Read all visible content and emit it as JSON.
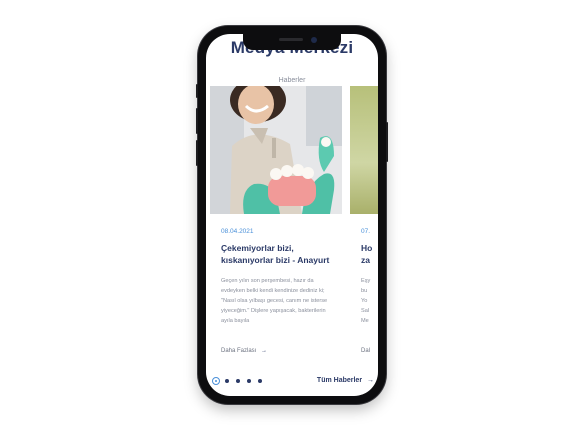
{
  "header": {
    "title": "Medya Merkezi",
    "subtitle": "Haberler"
  },
  "cards": [
    {
      "date": "08.04.2021",
      "headline": "Çekemiyorlar bizi, kıskanıyorlar bizi - Anayurt",
      "excerpt": "Geçen yılın son perşembesi, hazır da evdeyken belki kendi kendinize dediniz ki; \"Nasıl olsa yılbaşı gecesi, canım ne isterse yiyeceğim.\" Dişlere yapışacak, bakterilerin ayıla bayıla",
      "more_label": "Daha Fazlası",
      "more_arrow": "→"
    },
    {
      "date": "07.",
      "headline_line1": "Ho",
      "headline_line2": "za",
      "excerpt_lines": [
        "Eşy",
        "bu",
        "Yo",
        "Sal",
        "Me"
      ],
      "more_label": "Dal"
    }
  ],
  "pagination": {
    "count": 5,
    "active": 0
  },
  "footer": {
    "all_news_label": "Tüm Haberler",
    "all_news_arrow": "→"
  },
  "colors": {
    "primary": "#2b3a67",
    "accent": "#4a90d9",
    "muted": "#8a8f9c",
    "phone_frame": "#0d0d0f"
  }
}
